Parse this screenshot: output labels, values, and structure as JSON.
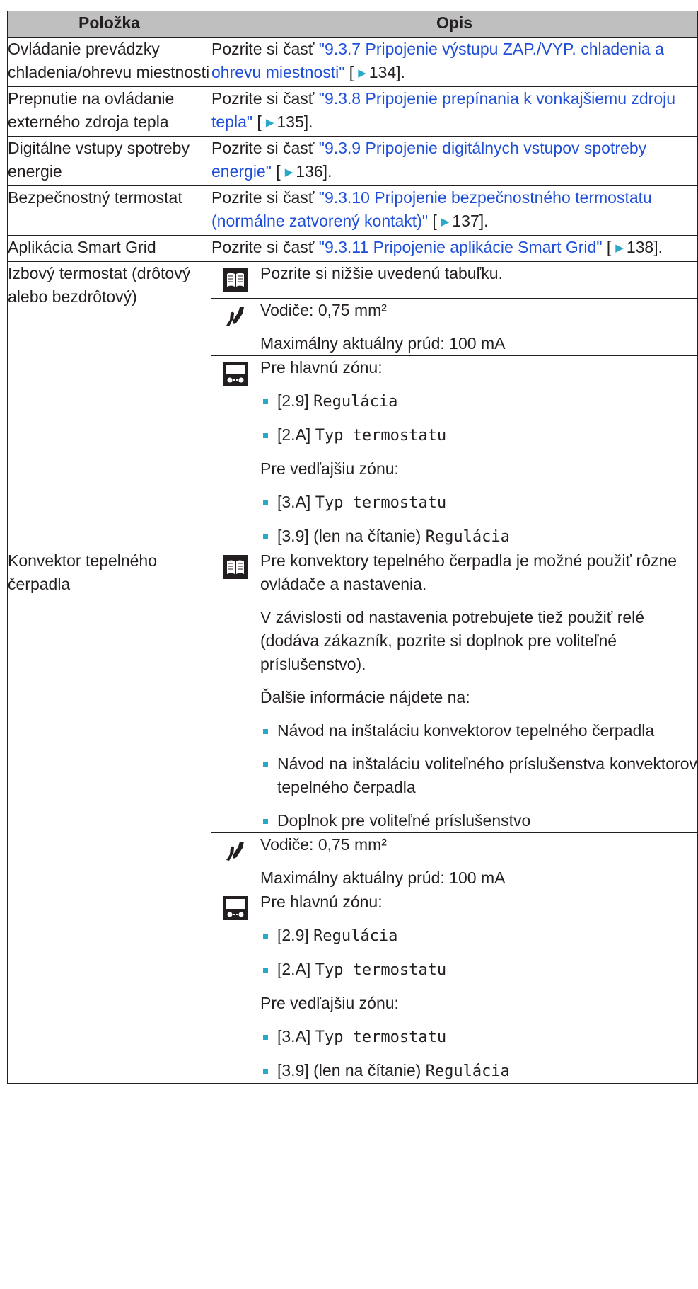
{
  "header": {
    "col1": "Položka",
    "col2": "Opis"
  },
  "simple_rows": [
    {
      "item": "Ovládanie prevádzky chladenia/ohrevu miestnosti",
      "prefix": "Pozrite si časť ",
      "link": "\"9.3.7 Pripojenie výstupu ZAP./VYP. chladenia a ohrevu miestnosti\"",
      "page_open": " [",
      "page": "134",
      "page_close": "]."
    },
    {
      "item": "Prepnutie na ovládanie externého zdroja tepla",
      "prefix": "Pozrite si časť ",
      "link": "\"9.3.8 Pripojenie prepínania k vonkajšiemu zdroju tepla\"",
      "page_open": " [",
      "page": "135",
      "page_close": "]."
    },
    {
      "item": "Digitálne vstupy spotreby energie",
      "prefix": "Pozrite si časť ",
      "link": "\"9.3.9 Pripojenie digitálnych vstupov spotreby energie\"",
      "page_open": " [",
      "page": "136",
      "page_close": "]."
    },
    {
      "item": "Bezpečnostný termostat",
      "prefix": "Pozrite si časť ",
      "link": "\"9.3.10 Pripojenie bezpečnostného termostatu (normálne zatvorený kontakt)\"",
      "page_open": " [",
      "page": "137",
      "page_close": "]."
    },
    {
      "item": "Aplikácia Smart Grid",
      "prefix": "Pozrite si časť ",
      "link": "\"9.3.11 Pripojenie aplikácie Smart Grid\"",
      "page_open": " [",
      "page": "138",
      "page_close": "]."
    }
  ],
  "thermostat": {
    "item": "Izbový termostat (drôtový alebo bezdrôtový)",
    "book_text": "Pozrite si nižšie uvedenú tabuľku.",
    "wire_line1": "Vodiče: 0,75 mm²",
    "wire_line2": "Maximálny aktuálny prúd: 100 mA",
    "ui_main": "Pre hlavnú zónu:",
    "ui_b1_code": "[2.9] ",
    "ui_b1_name": "Regulácia",
    "ui_b2_code": "[2.A] ",
    "ui_b2_name": "Typ termostatu",
    "ui_sec": "Pre vedľajšiu zónu:",
    "ui_b3_code": "[3.A] ",
    "ui_b3_name": "Typ termostatu",
    "ui_b4_code": "[3.9] (len na čítanie) ",
    "ui_b4_name": "Regulácia"
  },
  "convector": {
    "item": "Konvektor tepelného čerpadla",
    "book_p1": "Pre konvektory tepelného čerpadla je možné použiť rôzne ovládače a nastavenia.",
    "book_p2": "V závislosti od nastavenia potrebujete tiež použiť relé (dodáva zákazník, pozrite si doplnok pre voliteľné príslušenstvo).",
    "book_p3": "Ďalšie informácie nájdete na:",
    "book_b1": "Návod na inštaláciu konvektorov tepelného čerpadla",
    "book_b2": "Návod na inštaláciu voliteľného príslušenstva konvektorov tepelného čerpadla",
    "book_b3": "Doplnok pre voliteľné príslušenstvo",
    "wire_line1": "Vodiče: 0,75 mm²",
    "wire_line2": "Maximálny aktuálny prúd: 100 mA",
    "ui_main": "Pre hlavnú zónu:",
    "ui_b1_code": "[2.9] ",
    "ui_b1_name": "Regulácia",
    "ui_b2_code": "[2.A] ",
    "ui_b2_name": "Typ termostatu",
    "ui_sec": "Pre vedľajšiu zónu:",
    "ui_b3_code": "[3.A] ",
    "ui_b3_name": "Typ termostatu",
    "ui_b4_code": "[3.9] (len na čítanie) ",
    "ui_b4_name": "Regulácia"
  },
  "icons": {
    "book": "book-icon",
    "wire": "wire-icon",
    "ui": "user-interface-icon"
  },
  "colors": {
    "link": "#1f4fd8",
    "bullet": "#2aa8c9",
    "header_bg": "#bfbfbf",
    "border": "#231f20"
  }
}
